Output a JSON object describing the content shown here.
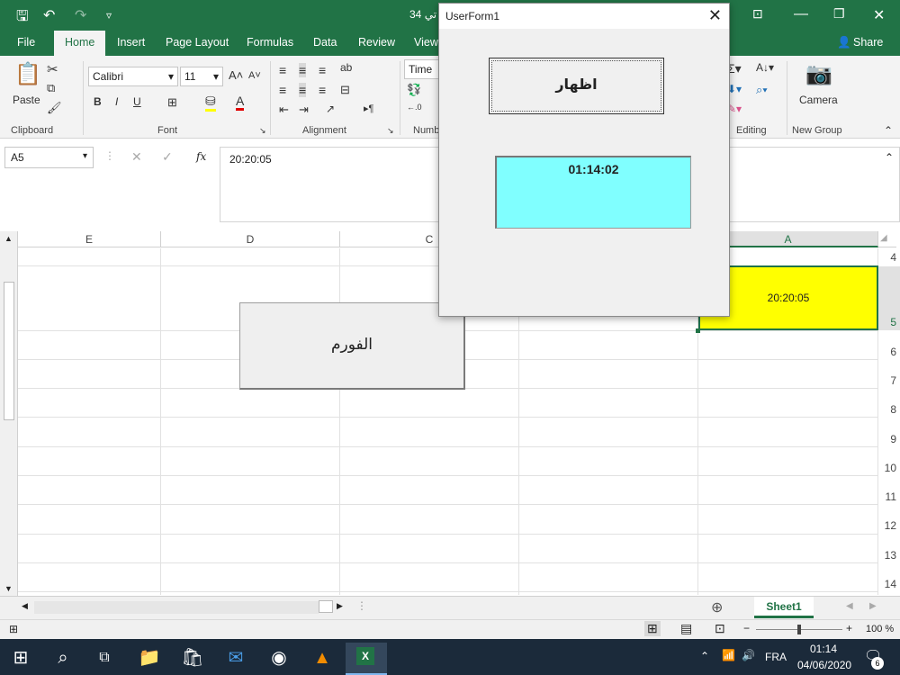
{
  "titlebar": {
    "doc_title_fragment": "تي 34",
    "color": "#217346"
  },
  "tabs": [
    "File",
    "Home",
    "Insert",
    "Page Layout",
    "Formulas",
    "Data",
    "Review",
    "View"
  ],
  "share_label": "Share",
  "ribbon": {
    "paste_label": "Paste",
    "font_name": "Calibri",
    "font_size": "11",
    "bold": "B",
    "italic": "I",
    "underline": "U",
    "number_format": "Time",
    "camera_label": "Camera",
    "groups": {
      "clipboard": "Clipboard",
      "font": "Font",
      "alignment": "Alignment",
      "number": "Numb",
      "editing": "Editing",
      "new_group": "New Group"
    }
  },
  "formula_bar": {
    "name_box": "A5",
    "fx": "fx",
    "content": "20:20:05"
  },
  "columns": [
    "E",
    "D",
    "C",
    "B",
    "A"
  ],
  "rows": [
    "4",
    "5",
    "6",
    "7",
    "8",
    "9",
    "10",
    "11",
    "12",
    "13",
    "14"
  ],
  "cell_A5": {
    "value": "20:20:05",
    "fill": "#ffff00"
  },
  "sheet_button": {
    "label": "الفورم"
  },
  "userform": {
    "title": "UserForm1",
    "close": "✕",
    "button_label": "اظهار",
    "label_value": "01:14:02",
    "label_color": "#80ffff"
  },
  "sheet_tab": "Sheet1",
  "status": {
    "zoom": "100 %"
  },
  "taskbar": {
    "time": "01:14",
    "date": "04/06/2020",
    "lang": "FRA",
    "notifications": "6"
  }
}
